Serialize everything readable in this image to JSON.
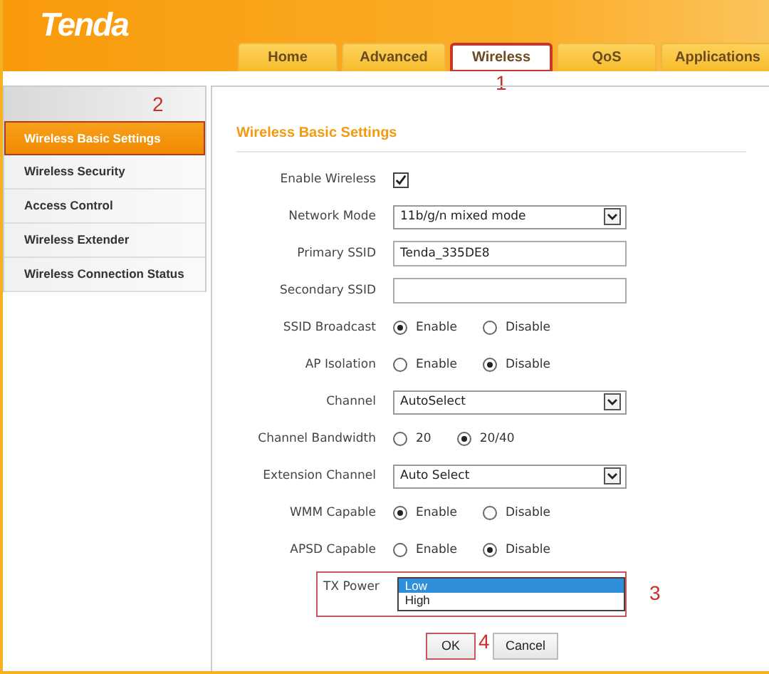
{
  "logo": "Tenda",
  "tabs": [
    {
      "label": "Home",
      "selected": false
    },
    {
      "label": "Advanced",
      "selected": false
    },
    {
      "label": "Wireless",
      "selected": true,
      "marker": "1"
    },
    {
      "label": "QoS",
      "selected": false
    },
    {
      "label": "Applications",
      "selected": false
    }
  ],
  "sidebar": {
    "marker": "2",
    "items": [
      {
        "label": "Wireless Basic Settings",
        "selected": true
      },
      {
        "label": "Wireless Security",
        "selected": false
      },
      {
        "label": "Access Control",
        "selected": false
      },
      {
        "label": "Wireless Extender",
        "selected": false
      },
      {
        "label": "Wireless Connection Status",
        "selected": false
      }
    ]
  },
  "panel": {
    "title": "Wireless Basic Settings",
    "rows": [
      {
        "kind": "checkbox",
        "label": "Enable Wireless",
        "checked": true
      },
      {
        "kind": "select",
        "label": "Network Mode",
        "value": "11b/g/n mixed mode"
      },
      {
        "kind": "text",
        "label": "Primary SSID",
        "value": "Tenda_335DE8"
      },
      {
        "kind": "text",
        "label": "Secondary SSID"
      },
      {
        "kind": "radio",
        "label": "SSID Broadcast",
        "options": [
          {
            "label": "Enable",
            "selected": true
          },
          {
            "label": "Disable",
            "selected": false
          }
        ]
      },
      {
        "kind": "radio",
        "label": "AP Isolation",
        "options": [
          {
            "label": "Enable",
            "selected": false
          },
          {
            "label": "Disable",
            "selected": true
          }
        ]
      },
      {
        "kind": "select",
        "label": "Channel",
        "value": "AutoSelect"
      },
      {
        "kind": "radio",
        "label": "Channel Bandwidth",
        "options": [
          {
            "label": "20",
            "selected": false
          },
          {
            "label": "20/40",
            "selected": true
          }
        ]
      },
      {
        "kind": "select",
        "label": "Extension Channel",
        "value": "Auto Select"
      },
      {
        "kind": "radio",
        "label": "WMM Capable",
        "options": [
          {
            "label": "Enable",
            "selected": true
          },
          {
            "label": "Disable",
            "selected": false
          }
        ]
      },
      {
        "kind": "radio",
        "label": "APSD Capable",
        "options": [
          {
            "label": "Enable",
            "selected": false
          },
          {
            "label": "Disable",
            "selected": true
          }
        ]
      },
      {
        "kind": "listbox",
        "label": "TX Power",
        "marker": "3",
        "options": [
          {
            "label": "Low",
            "selected": true
          },
          {
            "label": "High",
            "selected": false
          }
        ]
      }
    ],
    "buttons": [
      {
        "label": "OK",
        "marker": "4"
      },
      {
        "label": "Cancel"
      }
    ]
  }
}
